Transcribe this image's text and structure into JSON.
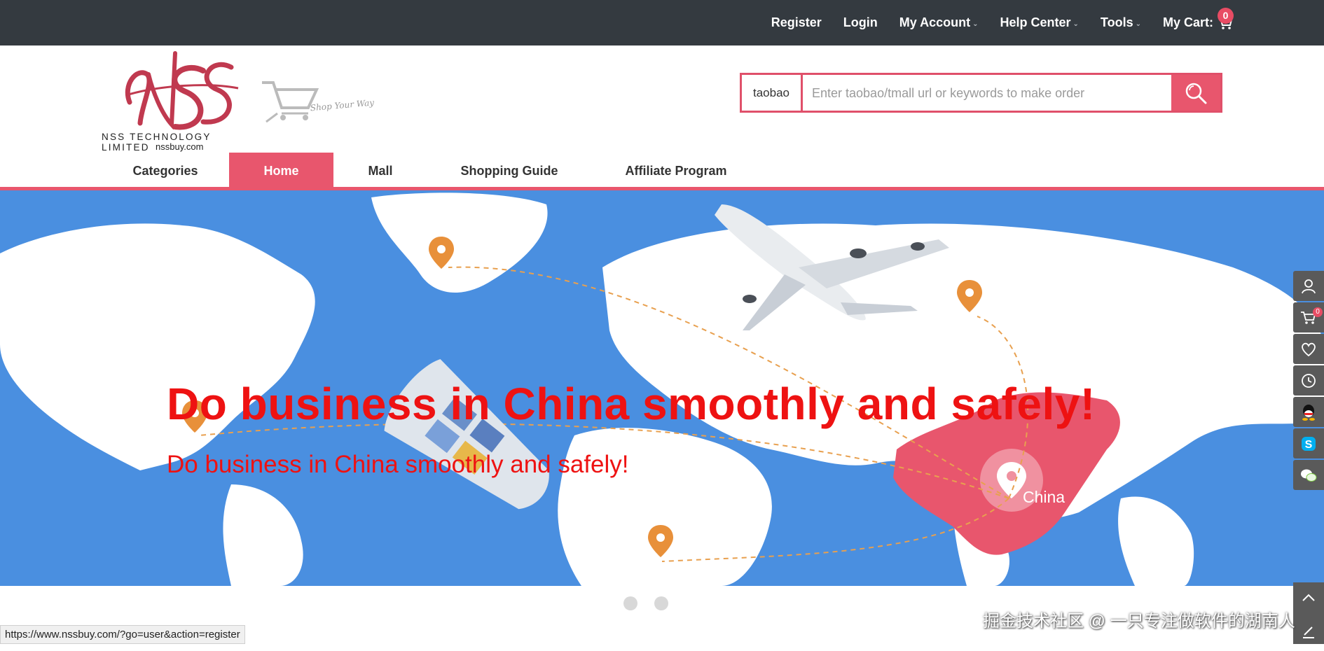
{
  "topbar": {
    "items": [
      {
        "label": "Register",
        "dropdown": false
      },
      {
        "label": "Login",
        "dropdown": false
      },
      {
        "label": "My Account",
        "dropdown": true
      },
      {
        "label": "Help Center",
        "dropdown": true
      },
      {
        "label": "Tools",
        "dropdown": true
      },
      {
        "label": "My Cart:",
        "dropdown": false
      }
    ],
    "cart_count": "0"
  },
  "logo": {
    "company": "NSS TECHNOLOGY LIMITED",
    "domain": "nssbuy.com",
    "tagline": "Shop Your Way"
  },
  "search": {
    "platform": "taobao",
    "placeholder": "Enter taobao/tmall url or keywords to make order",
    "value": ""
  },
  "nav": {
    "items": [
      {
        "label": "Categories"
      },
      {
        "label": "Home",
        "active": true
      },
      {
        "label": "Mall"
      },
      {
        "label": "Shopping Guide"
      },
      {
        "label": "Affiliate Program"
      }
    ]
  },
  "banner": {
    "headline": "Do business in China smoothly and safely!",
    "subline": "Do business in China smoothly and safely!",
    "map_label": "China",
    "slide_count": 2
  },
  "sidebar": {
    "icons": [
      "user-icon",
      "cart-icon",
      "heart-icon",
      "history-icon",
      "qq-icon",
      "skype-icon",
      "wechat-icon"
    ],
    "cart_count": "0"
  },
  "watermark": "掘金技术社区 @ 一只专注做软件的湖南人",
  "statusbar": "https://www.nssbuy.com/?go=user&action=register",
  "colors": {
    "topbar": "#343a40",
    "accent": "#e8566d",
    "banner": "#4a8fe0",
    "headline": "#ee1212"
  }
}
